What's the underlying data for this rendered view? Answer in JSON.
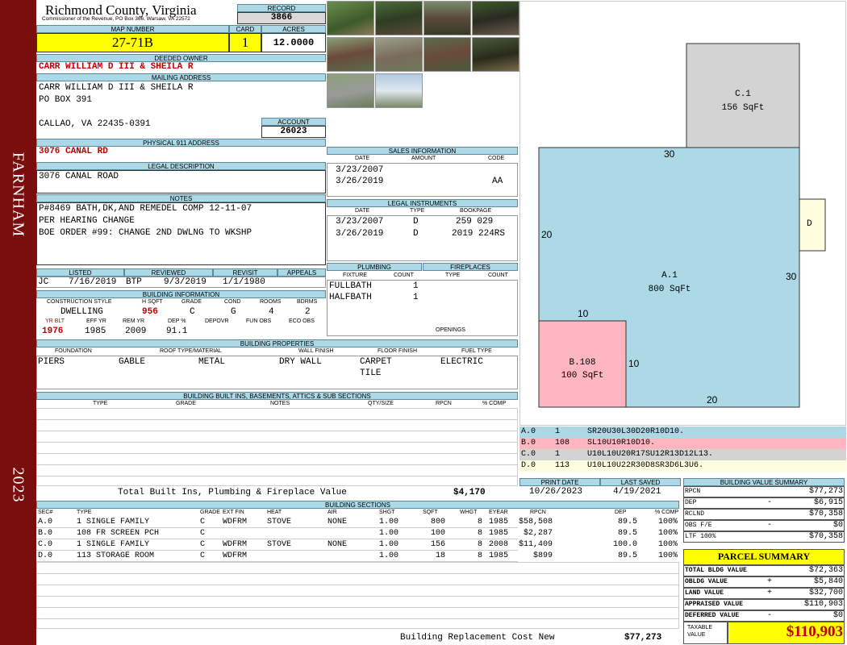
{
  "county": "Richmond County, Virginia",
  "commissioner": "Commissioner of the Revenue, PO Box 366, Warsaw, VA 22572",
  "district": "FARNHAM",
  "year": "2023",
  "labels": {
    "record": "RECORD",
    "map_number": "MAP NUMBER",
    "card": "CARD",
    "acres": "ACRES",
    "deeded_owner": "DEEDED OWNER",
    "mailing_address": "MAILING ADDRESS",
    "account": "ACCOUNT",
    "physical_address": "PHYSICAL 911 ADDRESS",
    "legal_description": "LEGAL DESCRIPTION",
    "notes": "NOTES",
    "sales_information": "SALES INFORMATION",
    "legal_instruments": "LEGAL INSTRUMENTS",
    "listed": "LISTED",
    "reviewed": "REVIEWED",
    "revisit": "REVISIT",
    "appeals": "APPEALS",
    "building_information": "BUILDING INFORMATION",
    "plumbing": "PLUMBING",
    "fireplaces": "FIREPLACES",
    "building_properties": "BUILDING PROPERTIES",
    "builtins": "BUILDING BUILT INS, BASEMENTS, ATTICS & SUB SECTIONS",
    "building_sections": "BUILDING SECTIONS",
    "print_date": "PRINT DATE",
    "last_saved": "LAST SAVED",
    "bv_summary": "BUILDING VALUE SUMMARY",
    "parcel_summary": "PARCEL SUMMARY",
    "openings": "OPENINGS",
    "total_builtins": "Total Built Ins, Plumbing & Fireplace Value",
    "replacement_cost": "Building Replacement Cost New",
    "taxable_value": "TAXABLE VALUE"
  },
  "record": "3866",
  "map_number": "27-71B",
  "card": "1",
  "acres": "12.0000",
  "deeded_owner": "CARR WILLIAM D III & SHEILA R",
  "mailing": [
    "CARR WILLIAM D III & SHEILA R",
    "PO BOX 391",
    "",
    "CALLAO, VA 22435-0391"
  ],
  "account": "26023",
  "physical_address": "3076 CANAL RD",
  "legal_description": "3076 CANAL ROAD",
  "notes": [
    "P#8469 BATH,DK,AND REMEDEL COMP 12-11-07",
    "PER HEARING CHANGE",
    "BOE ORDER #99: CHANGE 2ND DWLNG TO WKSHP"
  ],
  "sales": {
    "headers": [
      "DATE",
      "AMOUNT",
      "CODE"
    ],
    "rows": [
      [
        "3/23/2007",
        "",
        ""
      ],
      [
        "3/26/2019",
        "",
        "AA"
      ]
    ]
  },
  "instruments": {
    "headers": [
      "DATE",
      "TYPE",
      "BOOKPAGE"
    ],
    "rows": [
      [
        "3/23/2007",
        "D",
        "259 029"
      ],
      [
        "3/26/2019",
        "D",
        "2019 224RS"
      ]
    ]
  },
  "review": {
    "listed_by": "JC",
    "listed": "7/16/2019",
    "reviewed_by": "BTP",
    "reviewed": "9/3/2019",
    "revisit": "1/1/1980",
    "appeals": ""
  },
  "bldg_info": {
    "headers": [
      "CONSTRUCTION STYLE",
      "H SQFT",
      "GRADE",
      "COND",
      "ROOMS",
      "BDRMS"
    ],
    "values": [
      "DWELLING",
      "956",
      "C",
      "G",
      "4",
      "2"
    ],
    "headers2": [
      "YR BLT",
      "EFF YR",
      "REM YR",
      "DEP %",
      "DEPOVR",
      "FUN OBS",
      "ECO OBS"
    ],
    "values2": [
      "1976",
      "1985",
      "2009",
      "91.1",
      "",
      "",
      ""
    ]
  },
  "plumbing": {
    "headers": [
      "FIXTURE",
      "COUNT"
    ],
    "rows": [
      [
        "FULLBATH",
        "1"
      ],
      [
        "HALFBATH",
        "1"
      ]
    ]
  },
  "fireplaces": {
    "headers": [
      "TYPE",
      "COUNT"
    ]
  },
  "properties": {
    "headers": [
      "FOUNDATION",
      "ROOF TYPE/MATERIAL",
      "WALL FINISH",
      "FLOOR FINISH",
      "FUEL TYPE"
    ],
    "foundation": "PIERS",
    "roof_type": "GABLE",
    "roof_material": "METAL",
    "wall": "DRY WALL",
    "floor": [
      "CARPET",
      "TILE"
    ],
    "fuel": "ELECTRIC"
  },
  "builtins_headers": [
    "TYPE",
    "GRADE",
    "NOTES",
    "QTY/SIZE",
    "RPCN",
    "% COMP"
  ],
  "total_builtins_value": "$4,170",
  "sections": {
    "headers": [
      "SEC#",
      "TYPE",
      "GRADE",
      "EXT FIN",
      "HEAT",
      "AIR",
      "SHGT",
      "SQFT",
      "WHGT",
      "EYEAR",
      "RPCN",
      "DEP",
      "% COMP"
    ],
    "rows": [
      [
        "A.0",
        "1 SINGLE FAMILY",
        "C",
        "WDFRM",
        "STOVE",
        "NONE",
        "1.00",
        "800",
        "8",
        "1985",
        "$58,508",
        "89.5",
        "100%"
      ],
      [
        "B.0",
        "108 FR SCREEN PCH",
        "C",
        "",
        "",
        "",
        "1.00",
        "100",
        "8",
        "1985",
        "$2,287",
        "89.5",
        "100%"
      ],
      [
        "C.0",
        "1 SINGLE FAMILY",
        "C",
        "WDFRM",
        "STOVE",
        "NONE",
        "1.00",
        "156",
        "8",
        "2008",
        "$11,409",
        "100.0",
        "100%"
      ],
      [
        "D.0",
        "113 STORAGE ROOM",
        "C",
        "WDFRM",
        "",
        "",
        "1.00",
        "18",
        "8",
        "1985",
        "$899",
        "89.5",
        "100%"
      ]
    ]
  },
  "replacement_cost_value": "$77,273",
  "print_date": "10/26/2023",
  "last_saved": "4/19/2021",
  "sketch": {
    "labels": [
      {
        "id": "C.1",
        "area": "156 SqFt"
      },
      {
        "id": "A.1",
        "area": "800 SqFt"
      },
      {
        "id": "B.108",
        "area": "100 SqFt"
      },
      {
        "id": "D",
        "area": ""
      }
    ],
    "dims": [
      "30",
      "20",
      "30",
      "10",
      "10",
      "20"
    ]
  },
  "sketch_codes": [
    [
      "A.0",
      "1",
      "SR20U30L30D20R10D10."
    ],
    [
      "B.0",
      "108",
      "SL10U10R10D10."
    ],
    [
      "C.0",
      "1",
      "U10L10U20R17SU12R13D12L13."
    ],
    [
      "D.0",
      "113",
      "U10L10U22R30D8SR3D6L3U6."
    ]
  ],
  "bv_summary": [
    [
      "RPCN",
      "",
      "$77,273"
    ],
    [
      "DEP",
      "-",
      "$6,915"
    ],
    [
      "RCLND",
      "",
      "$70,358"
    ],
    [
      "OBS F/E",
      "-",
      "$0"
    ],
    [
      "LTF 100%",
      "",
      "$70,358"
    ]
  ],
  "parcel_summary": [
    [
      "TOTAL BLDG VALUE",
      "",
      "$72,363"
    ],
    [
      "OBLDG VALUE",
      "+",
      "$5,840"
    ],
    [
      "LAND VALUE",
      "+",
      "$32,700"
    ],
    [
      "APPRAISED VALUE",
      "",
      "$110,903"
    ],
    [
      "DEFERRED VALUE",
      "-",
      "$0"
    ]
  ],
  "taxable_value": "$110,903",
  "colors": {
    "sidebar": "#7a0d0d",
    "header": "#add8e6",
    "highlight": "#ffff00",
    "red_text": "#c00000",
    "sketch_a": "#add8e6",
    "sketch_b": "#ffb6c1",
    "sketch_c": "#d3d3d3",
    "sketch_d": "#fffde0"
  }
}
